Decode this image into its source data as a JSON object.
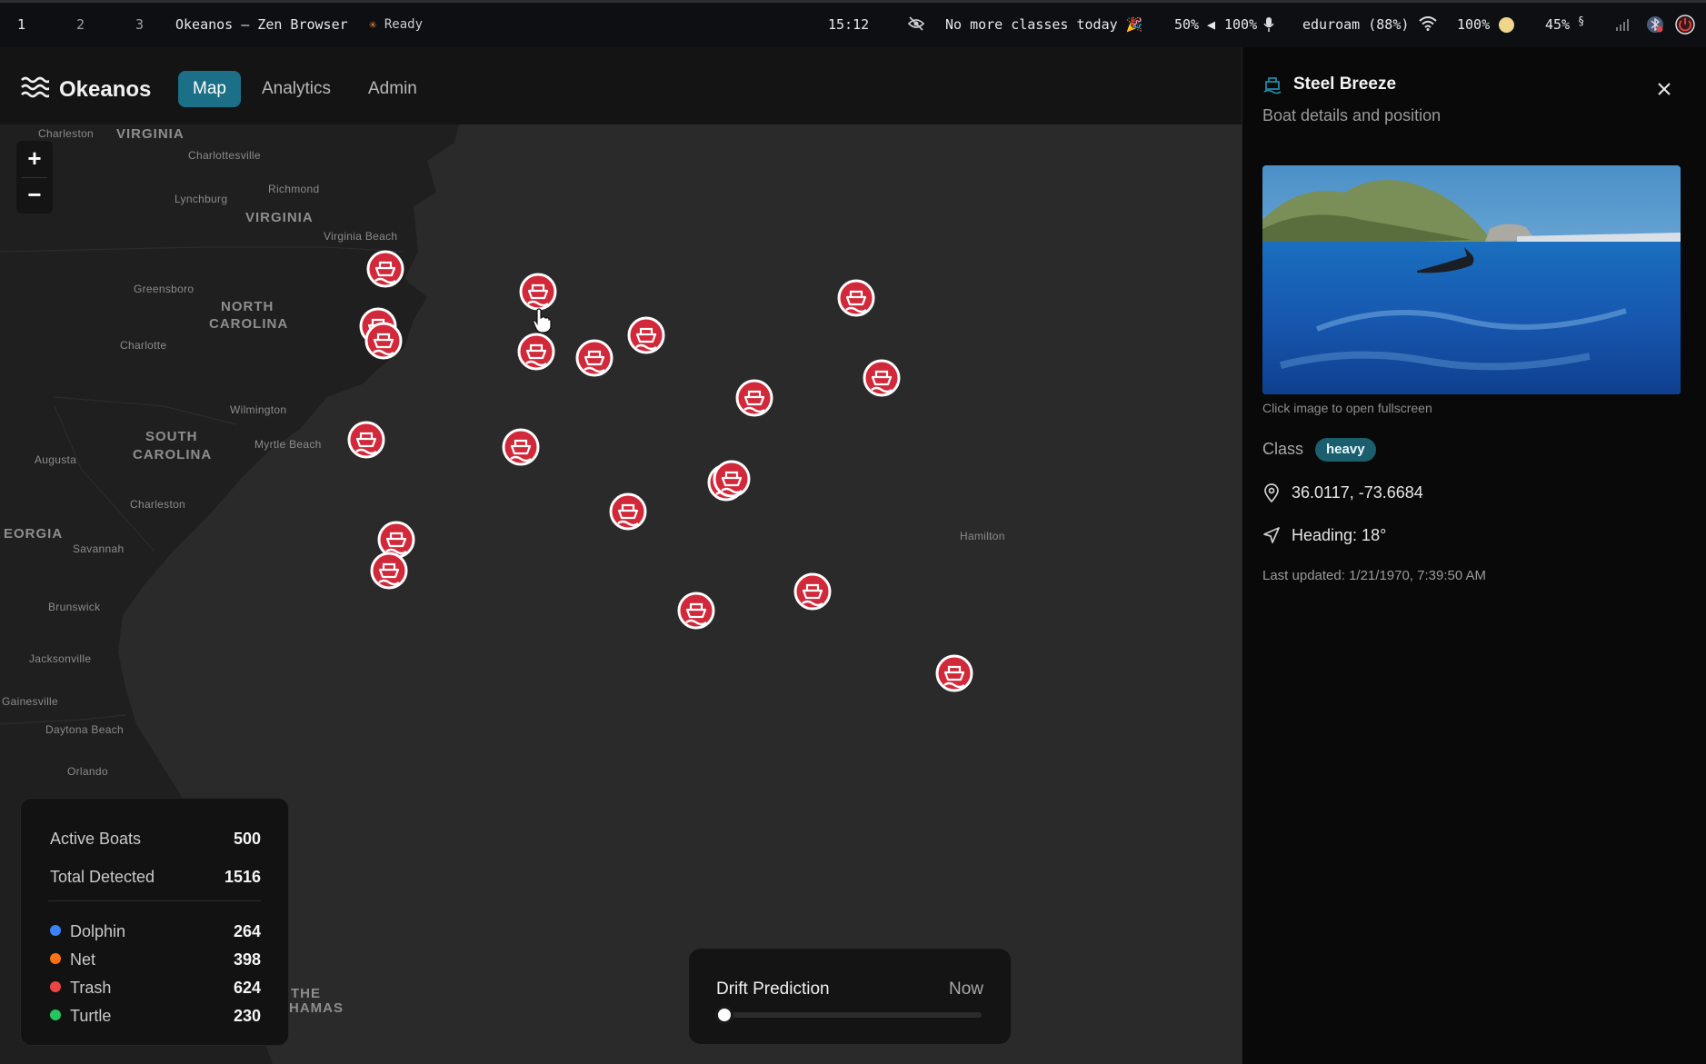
{
  "system_bar": {
    "workspaces": [
      "1",
      "2",
      "3"
    ],
    "window_title": "Okeanos — Zen Browser",
    "status": "Ready",
    "time": "15:12",
    "calendar": "No more classes today 🎉",
    "volume": "50%",
    "mic": "100%",
    "network": "eduroam (88%)",
    "battery": "100%",
    "brightness": "45%",
    "brightness_unit": "§"
  },
  "header": {
    "app_name": "Okeanos",
    "tabs": [
      {
        "label": "Map",
        "active": true
      },
      {
        "label": "Analytics",
        "active": false
      },
      {
        "label": "Admin",
        "active": false
      }
    ]
  },
  "map": {
    "zoom_in": "+",
    "zoom_out": "−",
    "labels": [
      {
        "text": "Charleston",
        "type": "city"
      },
      {
        "text": "VIRGINIA",
        "type": "state"
      },
      {
        "text": "Charlottesville",
        "type": "city"
      },
      {
        "text": "Lynchburg",
        "type": "city"
      },
      {
        "text": "Richmond",
        "type": "city"
      },
      {
        "text": "VIRGINIA",
        "type": "state"
      },
      {
        "text": "Virginia Beach",
        "type": "city"
      },
      {
        "text": "Greensboro",
        "type": "city"
      },
      {
        "text": "NORTH",
        "type": "state"
      },
      {
        "text": "CAROLINA",
        "type": "state"
      },
      {
        "text": "Charlotte",
        "type": "city"
      },
      {
        "text": "Wilmington",
        "type": "city"
      },
      {
        "text": "SOUTH",
        "type": "state"
      },
      {
        "text": "CAROLINA",
        "type": "state"
      },
      {
        "text": "Myrtle Beach",
        "type": "city"
      },
      {
        "text": "Augusta",
        "type": "city"
      },
      {
        "text": "Charleston",
        "type": "city"
      },
      {
        "text": "EORGIA",
        "type": "state"
      },
      {
        "text": "Savannah",
        "type": "city"
      },
      {
        "text": "Brunswick",
        "type": "city"
      },
      {
        "text": "Jacksonville",
        "type": "city"
      },
      {
        "text": "Gainesville",
        "type": "city"
      },
      {
        "text": "Daytona Beach",
        "type": "city"
      },
      {
        "text": "Orlando",
        "type": "city"
      },
      {
        "text": "Hamilton",
        "type": "city"
      },
      {
        "text": "THE",
        "type": "state"
      },
      {
        "text": "HAMAS",
        "type": "state"
      }
    ],
    "boat_marker_color": "#d1293a",
    "boat_count_on_screen": 20
  },
  "stats": {
    "active_boats_label": "Active Boats",
    "active_boats": "500",
    "total_detected_label": "Total Detected",
    "total_detected": "1516",
    "categories": [
      {
        "label": "Dolphin",
        "value": "264",
        "color": "#3b82f6"
      },
      {
        "label": "Net",
        "value": "398",
        "color": "#f97316"
      },
      {
        "label": "Trash",
        "value": "624",
        "color": "#ef4444"
      },
      {
        "label": "Turtle",
        "value": "230",
        "color": "#22c55e"
      }
    ]
  },
  "drift": {
    "title": "Drift Prediction",
    "time_label": "Now",
    "slider_value": 0
  },
  "details": {
    "boat_name": "Steel Breeze",
    "subtitle": "Boat details and position",
    "caption": "Click image to open fullscreen",
    "class_label": "Class",
    "class_value": "heavy",
    "coordinates": "36.0117, -73.6684",
    "heading": "Heading: 18°",
    "last_updated": "Last updated: 1/21/1970, 7:39:50 AM"
  }
}
